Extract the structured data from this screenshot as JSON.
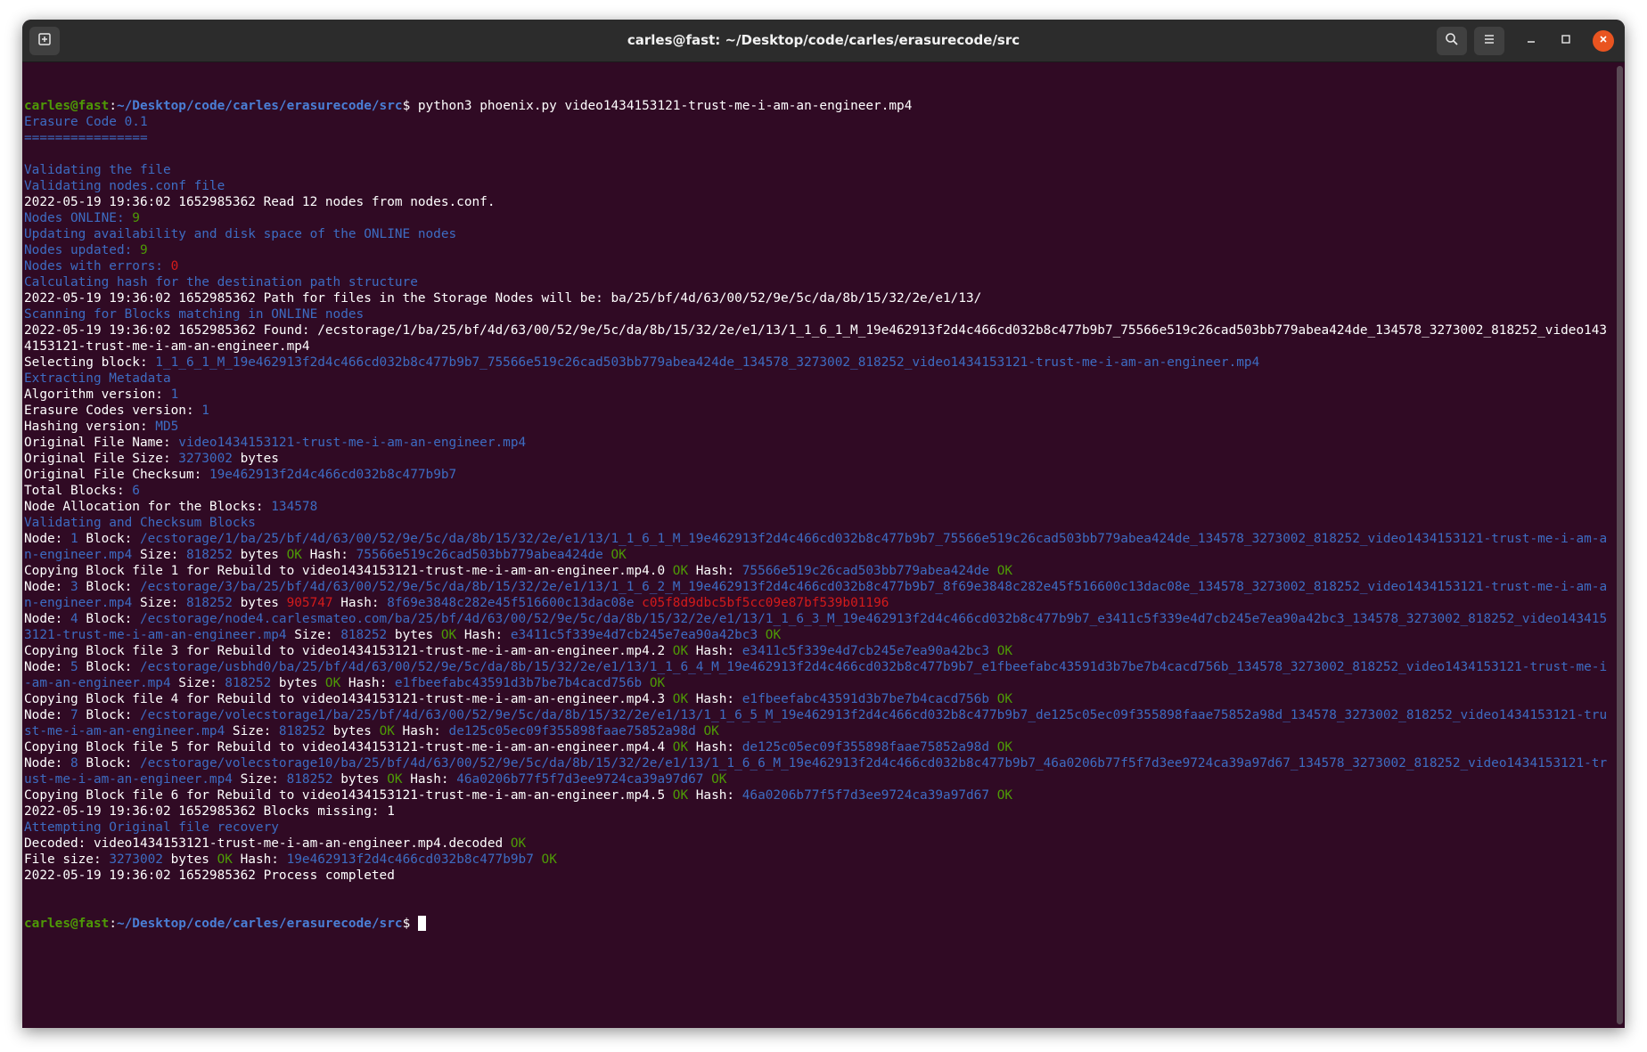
{
  "window": {
    "title": "carles@fast: ~/Desktop/code/carles/erasurecode/src"
  },
  "icons": {
    "new_tab": "new-tab-icon",
    "search": "search-icon",
    "menu": "hamburger-menu-icon",
    "minimize": "minimize-icon",
    "maximize": "maximize-icon",
    "close": "close-icon"
  },
  "colors": {
    "background": "#300a24",
    "text": "#ffffff",
    "info_blue": "#3d6cc2",
    "ok_green": "#4e9a06",
    "error_red": "#d41b1b",
    "close_button": "#e95420"
  },
  "terminal": {
    "lines": [
      [
        [
          "pu",
          "carles@fast"
        ],
        [
          "w",
          ":"
        ],
        [
          "pp",
          "~/Desktop/code/carles/erasurecode/src"
        ],
        [
          "w",
          "$ python3 phoenix.py video1434153121-trust-me-i-am-an-engineer.mp4"
        ]
      ],
      [
        [
          "b",
          "Erasure Code 0.1"
        ]
      ],
      [
        [
          "b",
          "================"
        ]
      ],
      [],
      [
        [
          "b",
          "Validating the file"
        ]
      ],
      [
        [
          "b",
          "Validating nodes.conf file"
        ]
      ],
      [
        [
          "w",
          "2022-05-19 19:36:02 1652985362 Read 12 nodes from nodes.conf."
        ]
      ],
      [
        [
          "b",
          "Nodes ONLINE: "
        ],
        [
          "g",
          "9"
        ]
      ],
      [
        [
          "b",
          "Updating availability and disk space of the ONLINE nodes"
        ]
      ],
      [
        [
          "b",
          "Nodes updated: "
        ],
        [
          "g",
          "9"
        ]
      ],
      [
        [
          "b",
          "Nodes with errors: "
        ],
        [
          "r",
          "0"
        ]
      ],
      [
        [
          "b",
          "Calculating hash for the destination path structure"
        ]
      ],
      [
        [
          "w",
          "2022-05-19 19:36:02 1652985362 Path for files in the Storage Nodes will be: ba/25/bf/4d/63/00/52/9e/5c/da/8b/15/32/2e/e1/13/"
        ]
      ],
      [
        [
          "b",
          "Scanning for Blocks matching in ONLINE nodes"
        ]
      ],
      [
        [
          "w",
          "2022-05-19 19:36:02 1652985362 Found: /ecstorage/1/ba/25/bf/4d/63/00/52/9e/5c/da/8b/15/32/2e/e1/13/1_1_6_1_M_19e462913f2d4c466cd032b8c477b9b7_75566e519c26cad503bb779abea424de_134578_3273002_818252_video1434153121-trust-me-i-am-an-engineer.mp4"
        ]
      ],
      [
        [
          "w",
          "Selecting block: "
        ],
        [
          "b",
          "1_1_6_1_M_19e462913f2d4c466cd032b8c477b9b7_75566e519c26cad503bb779abea424de_134578_3273002_818252_video1434153121-trust-me-i-am-an-engineer.mp4"
        ]
      ],
      [
        [
          "b",
          "Extracting Metadata"
        ]
      ],
      [
        [
          "w",
          "Algorithm version: "
        ],
        [
          "b",
          "1"
        ]
      ],
      [
        [
          "w",
          "Erasure Codes version: "
        ],
        [
          "b",
          "1"
        ]
      ],
      [
        [
          "w",
          "Hashing version: "
        ],
        [
          "b",
          "MD5"
        ]
      ],
      [
        [
          "w",
          "Original File Name: "
        ],
        [
          "b",
          "video1434153121-trust-me-i-am-an-engineer.mp4"
        ]
      ],
      [
        [
          "w",
          "Original File Size: "
        ],
        [
          "b",
          "3273002"
        ],
        [
          "w",
          " bytes"
        ]
      ],
      [
        [
          "w",
          "Original File Checksum: "
        ],
        [
          "b",
          "19e462913f2d4c466cd032b8c477b9b7"
        ]
      ],
      [
        [
          "w",
          "Total Blocks: "
        ],
        [
          "b",
          "6"
        ]
      ],
      [
        [
          "w",
          "Node Allocation for the Blocks: "
        ],
        [
          "b",
          "134578"
        ]
      ],
      [
        [
          "b",
          "Validating and Checksum Blocks"
        ]
      ],
      [
        [
          "w",
          "Node: "
        ],
        [
          "b",
          "1"
        ],
        [
          "w",
          " Block: "
        ],
        [
          "b",
          "/ecstorage/1/ba/25/bf/4d/63/00/52/9e/5c/da/8b/15/32/2e/e1/13/1_1_6_1_M_19e462913f2d4c466cd032b8c477b9b7_75566e519c26cad503bb779abea424de_134578_3273002_818252_video1434153121-trust-me-i-am-an-engineer.mp4"
        ],
        [
          "w",
          " Size: "
        ],
        [
          "b",
          "818252"
        ],
        [
          "w",
          " bytes "
        ],
        [
          "g",
          "OK"
        ],
        [
          "w",
          " Hash: "
        ],
        [
          "b",
          "75566e519c26cad503bb779abea424de"
        ],
        [
          "w",
          " "
        ],
        [
          "g",
          "OK"
        ]
      ],
      [
        [
          "w",
          "Copying Block file 1 for Rebuild to video1434153121-trust-me-i-am-an-engineer.mp4.0 "
        ],
        [
          "g",
          "OK"
        ],
        [
          "w",
          " Hash: "
        ],
        [
          "b",
          "75566e519c26cad503bb779abea424de"
        ],
        [
          "w",
          " "
        ],
        [
          "g",
          "OK"
        ]
      ],
      [
        [
          "w",
          "Node: "
        ],
        [
          "b",
          "3"
        ],
        [
          "w",
          " Block: "
        ],
        [
          "b",
          "/ecstorage/3/ba/25/bf/4d/63/00/52/9e/5c/da/8b/15/32/2e/e1/13/1_1_6_2_M_19e462913f2d4c466cd032b8c477b9b7_8f69e3848c282e45f516600c13dac08e_134578_3273002_818252_video1434153121-trust-me-i-am-an-engineer.mp4"
        ],
        [
          "w",
          " Size: "
        ],
        [
          "b",
          "818252"
        ],
        [
          "w",
          " bytes "
        ],
        [
          "r",
          "905747"
        ],
        [
          "w",
          " Hash: "
        ],
        [
          "b",
          "8f69e3848c282e45f516600c13dac08e"
        ],
        [
          "w",
          " "
        ],
        [
          "r",
          "c05f8d9dbc5bf5cc09e87bf539b01196"
        ]
      ],
      [
        [
          "w",
          "Node: "
        ],
        [
          "b",
          "4"
        ],
        [
          "w",
          " Block: "
        ],
        [
          "b",
          "/ecstorage/node4.carlesmateo.com/ba/25/bf/4d/63/00/52/9e/5c/da/8b/15/32/2e/e1/13/1_1_6_3_M_19e462913f2d4c466cd032b8c477b9b7_e3411c5f339e4d7cb245e7ea90a42bc3_134578_3273002_818252_video1434153121-trust-me-i-am-an-engineer.mp4"
        ],
        [
          "w",
          " Size: "
        ],
        [
          "b",
          "818252"
        ],
        [
          "w",
          " bytes "
        ],
        [
          "g",
          "OK"
        ],
        [
          "w",
          " Hash: "
        ],
        [
          "b",
          "e3411c5f339e4d7cb245e7ea90a42bc3"
        ],
        [
          "w",
          " "
        ],
        [
          "g",
          "OK"
        ]
      ],
      [
        [
          "w",
          "Copying Block file 3 for Rebuild to video1434153121-trust-me-i-am-an-engineer.mp4.2 "
        ],
        [
          "g",
          "OK"
        ],
        [
          "w",
          " Hash: "
        ],
        [
          "b",
          "e3411c5f339e4d7cb245e7ea90a42bc3"
        ],
        [
          "w",
          " "
        ],
        [
          "g",
          "OK"
        ]
      ],
      [
        [
          "w",
          "Node: "
        ],
        [
          "b",
          "5"
        ],
        [
          "w",
          " Block: "
        ],
        [
          "b",
          "/ecstorage/usbhd0/ba/25/bf/4d/63/00/52/9e/5c/da/8b/15/32/2e/e1/13/1_1_6_4_M_19e462913f2d4c466cd032b8c477b9b7_e1fbeefabc43591d3b7be7b4cacd756b_134578_3273002_818252_video1434153121-trust-me-i-am-an-engineer.mp4"
        ],
        [
          "w",
          " Size: "
        ],
        [
          "b",
          "818252"
        ],
        [
          "w",
          " bytes "
        ],
        [
          "g",
          "OK"
        ],
        [
          "w",
          " Hash: "
        ],
        [
          "b",
          "e1fbeefabc43591d3b7be7b4cacd756b"
        ],
        [
          "w",
          " "
        ],
        [
          "g",
          "OK"
        ]
      ],
      [
        [
          "w",
          "Copying Block file 4 for Rebuild to video1434153121-trust-me-i-am-an-engineer.mp4.3 "
        ],
        [
          "g",
          "OK"
        ],
        [
          "w",
          " Hash: "
        ],
        [
          "b",
          "e1fbeefabc43591d3b7be7b4cacd756b"
        ],
        [
          "w",
          " "
        ],
        [
          "g",
          "OK"
        ]
      ],
      [
        [
          "w",
          "Node: "
        ],
        [
          "b",
          "7"
        ],
        [
          "w",
          " Block: "
        ],
        [
          "b",
          "/ecstorage/volecstorage1/ba/25/bf/4d/63/00/52/9e/5c/da/8b/15/32/2e/e1/13/1_1_6_5_M_19e462913f2d4c466cd032b8c477b9b7_de125c05ec09f355898faae75852a98d_134578_3273002_818252_video1434153121-trust-me-i-am-an-engineer.mp4"
        ],
        [
          "w",
          " Size: "
        ],
        [
          "b",
          "818252"
        ],
        [
          "w",
          " bytes "
        ],
        [
          "g",
          "OK"
        ],
        [
          "w",
          " Hash: "
        ],
        [
          "b",
          "de125c05ec09f355898faae75852a98d"
        ],
        [
          "w",
          " "
        ],
        [
          "g",
          "OK"
        ]
      ],
      [
        [
          "w",
          "Copying Block file 5 for Rebuild to video1434153121-trust-me-i-am-an-engineer.mp4.4 "
        ],
        [
          "g",
          "OK"
        ],
        [
          "w",
          " Hash: "
        ],
        [
          "b",
          "de125c05ec09f355898faae75852a98d"
        ],
        [
          "w",
          " "
        ],
        [
          "g",
          "OK"
        ]
      ],
      [
        [
          "w",
          "Node: "
        ],
        [
          "b",
          "8"
        ],
        [
          "w",
          " Block: "
        ],
        [
          "b",
          "/ecstorage/volecstorage10/ba/25/bf/4d/63/00/52/9e/5c/da/8b/15/32/2e/e1/13/1_1_6_6_M_19e462913f2d4c466cd032b8c477b9b7_46a0206b77f5f7d3ee9724ca39a97d67_134578_3273002_818252_video1434153121-trust-me-i-am-an-engineer.mp4"
        ],
        [
          "w",
          " Size: "
        ],
        [
          "b",
          "818252"
        ],
        [
          "w",
          " bytes "
        ],
        [
          "g",
          "OK"
        ],
        [
          "w",
          " Hash: "
        ],
        [
          "b",
          "46a0206b77f5f7d3ee9724ca39a97d67"
        ],
        [
          "w",
          " "
        ],
        [
          "g",
          "OK"
        ]
      ],
      [
        [
          "w",
          "Copying Block file 6 for Rebuild to video1434153121-trust-me-i-am-an-engineer.mp4.5 "
        ],
        [
          "g",
          "OK"
        ],
        [
          "w",
          " Hash: "
        ],
        [
          "b",
          "46a0206b77f5f7d3ee9724ca39a97d67"
        ],
        [
          "w",
          " "
        ],
        [
          "g",
          "OK"
        ]
      ],
      [
        [
          "w",
          "2022-05-19 19:36:02 1652985362 Blocks missing: 1"
        ]
      ],
      [
        [
          "b",
          "Attempting Original file recovery"
        ]
      ],
      [
        [
          "w",
          "Decoded: video1434153121-trust-me-i-am-an-engineer.mp4.decoded "
        ],
        [
          "g",
          "OK"
        ]
      ],
      [
        [
          "w",
          "File size: "
        ],
        [
          "b",
          "3273002"
        ],
        [
          "w",
          " bytes "
        ],
        [
          "g",
          "OK"
        ],
        [
          "w",
          " Hash: "
        ],
        [
          "b",
          "19e462913f2d4c466cd032b8c477b9b7"
        ],
        [
          "w",
          " "
        ],
        [
          "g",
          "OK"
        ]
      ],
      [
        [
          "w",
          "2022-05-19 19:36:02 1652985362 Process completed"
        ]
      ]
    ],
    "prompt": {
      "user_host": "carles@fast",
      "separator": ":",
      "path": "~/Desktop/code/carles/erasurecode/src",
      "symbol": "$ "
    }
  }
}
